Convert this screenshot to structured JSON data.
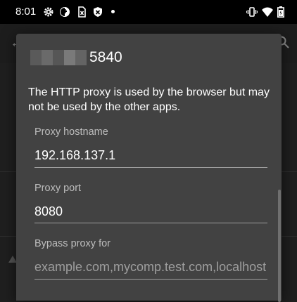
{
  "status_bar": {
    "time": "8:01",
    "left_icons": [
      "gear-icon",
      "data-saver-icon",
      "sim-card-icon",
      "shield-icon",
      "dot-icon"
    ],
    "right_icons": [
      "vibrate-icon",
      "wifi-icon",
      "battery-icon"
    ]
  },
  "dialog": {
    "title_suffix": "5840",
    "message": "The HTTP proxy is used by the browser but may not be used by the other apps.",
    "hostname": {
      "label": "Proxy hostname",
      "value": "192.168.137.1"
    },
    "port": {
      "label": "Proxy port",
      "value": "8080"
    },
    "bypass": {
      "label": "Bypass proxy for",
      "placeholder": "example.com,mycomp.test.com,localhost"
    }
  },
  "colors": {
    "dialog_bg": "#424242",
    "backdrop": "#1f1f1f",
    "hint_text": "#9e9e9e",
    "label_text": "#bdbdbd"
  }
}
